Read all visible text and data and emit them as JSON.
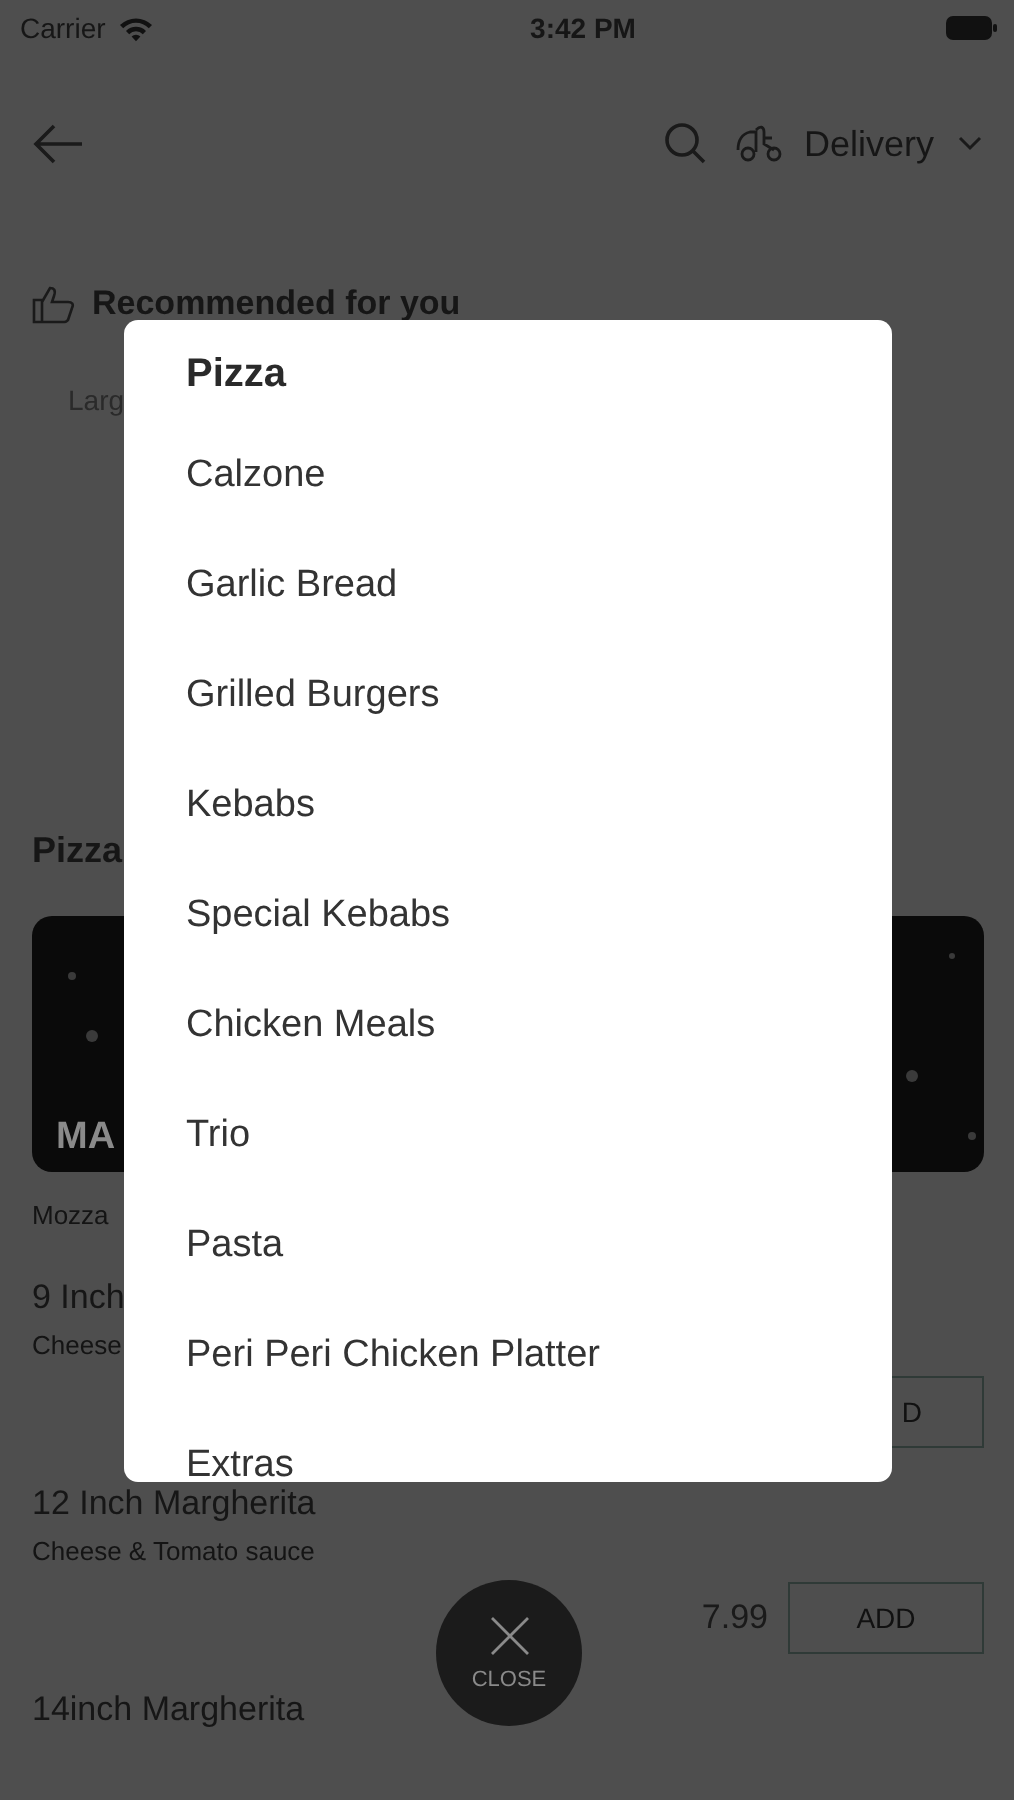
{
  "status_bar": {
    "carrier": "Carrier",
    "time": "3:42 PM"
  },
  "header": {
    "order_mode": "Delivery"
  },
  "recommended": {
    "title": "Recommended for you",
    "item": "Larg"
  },
  "section": {
    "title": "Pizza",
    "banner_text": "MA",
    "banner_caption": "Mozza"
  },
  "products": [
    {
      "name": "9 Inch",
      "description": "Cheese",
      "add_label": "D"
    },
    {
      "name": "12 Inch Margherita",
      "description": "Cheese & Tomato sauce",
      "price": "7.99",
      "add_label": "ADD"
    },
    {
      "name": "14inch Margherita"
    }
  ],
  "category_menu": {
    "title": "Pizza",
    "items": [
      "Calzone",
      "Garlic Bread",
      "Grilled Burgers",
      "Kebabs",
      "Special Kebabs",
      "Chicken Meals",
      "Trio",
      "Pasta",
      "Peri Peri Chicken Platter",
      "Extras"
    ]
  },
  "close_button": {
    "label": "CLOSE"
  }
}
